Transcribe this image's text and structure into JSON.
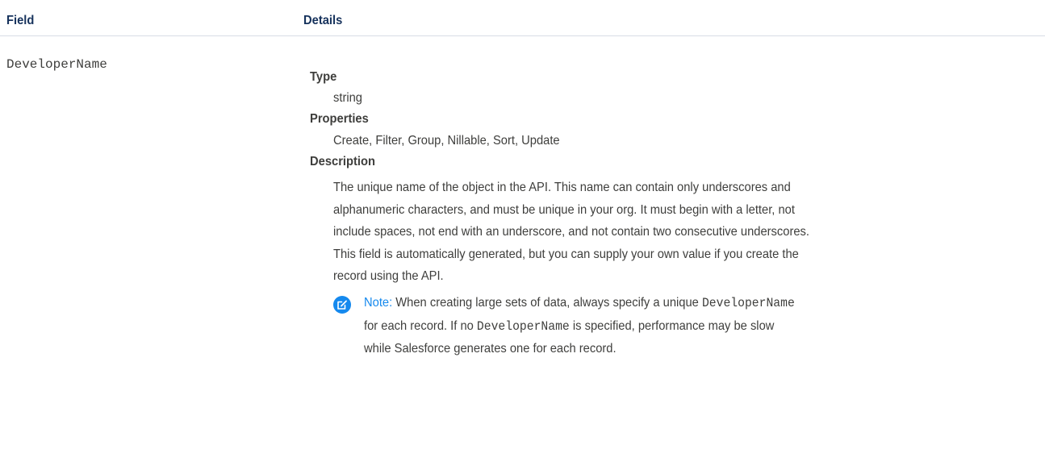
{
  "table": {
    "headers": {
      "field": "Field",
      "details": "Details"
    }
  },
  "row": {
    "field_name": "DeveloperName",
    "type_label": "Type",
    "type_value": "string",
    "properties_label": "Properties",
    "properties_value": "Create, Filter, Group, Nillable, Sort, Update",
    "description_label": "Description",
    "description_lines": [
      "The unique name of the object in the API. This name can contain only underscores and",
      "alphanumeric characters, and must be unique in your org. It must begin with a letter, not",
      "include spaces, not end with an underscore, and not contain two consecutive underscores.",
      "This field is automatically generated, but you can supply your own value if you create the",
      "record using the API."
    ],
    "note": {
      "icon": "edit-note-icon",
      "label": "Note:",
      "line1_text": "When creating large sets of data, always specify a unique",
      "line1_code": "DeveloperName",
      "line2_text_a": "for each record. If no",
      "line2_code": "DeveloperName",
      "line2_text_b": "is specified, performance may be slow",
      "line3_text": "while Salesforce generates one for each record.",
      "accent_color": "#1589ee"
    }
  }
}
